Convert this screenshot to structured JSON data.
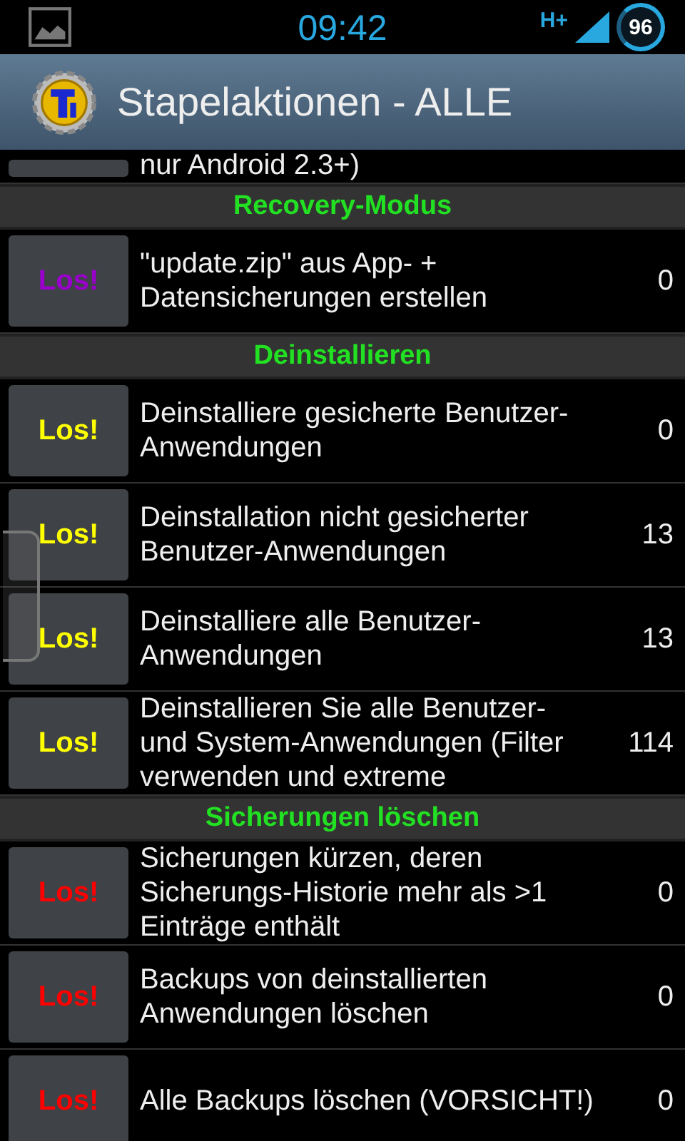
{
  "status_bar": {
    "time": "09:42",
    "network": "H+",
    "battery": "96"
  },
  "header": {
    "title": "Stapelaktionen - ALLE"
  },
  "list": [
    {
      "kind": "partial-row",
      "text": "nur Android 2.3+)"
    },
    {
      "kind": "section",
      "title": "Recovery-Modus"
    },
    {
      "kind": "row",
      "button": "Los!",
      "color": "#9900cc",
      "text": "\"update.zip\" aus App- + Datensicherungen erstellen",
      "count": "0"
    },
    {
      "kind": "section",
      "title": "Deinstallieren"
    },
    {
      "kind": "row",
      "button": "Los!",
      "color": "#ffff00",
      "text": "Deinstalliere gesicherte Benutzer-Anwendungen",
      "count": "0"
    },
    {
      "kind": "row",
      "button": "Los!",
      "color": "#ffff00",
      "text": "Deinstallation nicht gesicherter Benutzer-Anwendungen",
      "count": "13"
    },
    {
      "kind": "row",
      "button": "Los!",
      "color": "#ffff00",
      "text": "Deinstalliere alle Benutzer-Anwendungen",
      "count": "13"
    },
    {
      "kind": "row",
      "button": "Los!",
      "color": "#ffff00",
      "text": "Deinstallieren Sie alle Benutzer- und System-Anwendungen (Filter verwenden und extreme",
      "count": "114"
    },
    {
      "kind": "section",
      "title": "Sicherungen löschen"
    },
    {
      "kind": "row",
      "button": "Los!",
      "color": "#ff0000",
      "text": "Sicherungen kürzen, deren Sicherungs-Historie mehr als >1 Einträge enthält",
      "count": "0"
    },
    {
      "kind": "row",
      "button": "Los!",
      "color": "#ff0000",
      "text": "Backups von deinstallierten Anwendungen löschen",
      "count": "0"
    },
    {
      "kind": "row",
      "button": "Los!",
      "color": "#ff0000",
      "text": "Alle Backups löschen (VORSICHT!)",
      "count": "0"
    }
  ]
}
